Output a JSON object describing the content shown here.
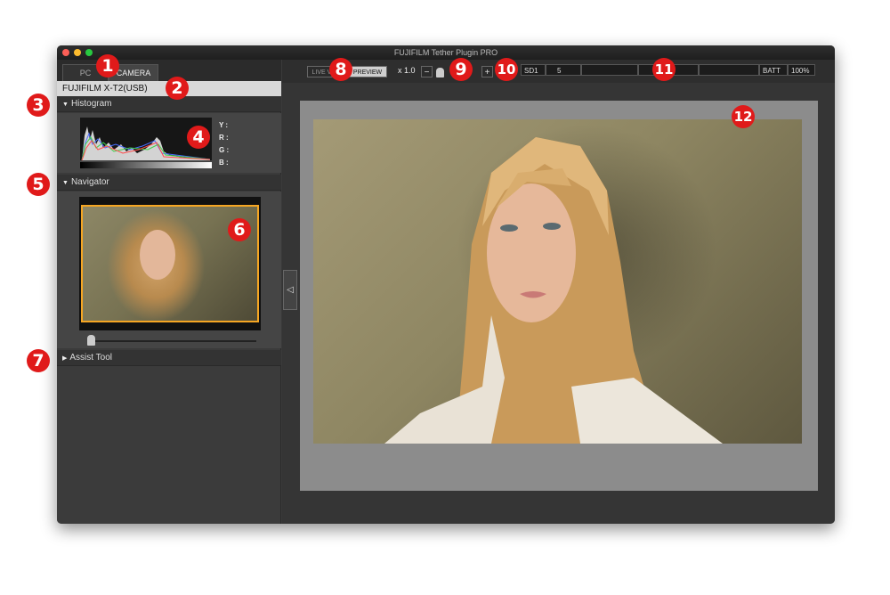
{
  "window": {
    "title": "FUJIFILM Tether Plugin PRO"
  },
  "tabs": [
    {
      "label": "PC"
    },
    {
      "label": "CAMERA"
    }
  ],
  "device": {
    "name": "FUJIFILM X-T2(USB)"
  },
  "sections": {
    "histogram": {
      "label": "Histogram",
      "readouts": [
        "Y :",
        "R :",
        "G :",
        "B :"
      ]
    },
    "navigator": {
      "label": "Navigator",
      "zoom_position": 0.05
    },
    "assist": {
      "label": "Assist Tool"
    }
  },
  "toolbar": {
    "live_view_label": "LIVE VIEW",
    "preview_label": "PREVIEW",
    "zoom_label": "x 1.0",
    "minus_label": "−",
    "plus_label": "+",
    "status": {
      "media": "SD1",
      "count": "5",
      "batt_label": "BATT",
      "batt_value": "100%"
    }
  },
  "collapse_glyph": "◁",
  "annotations": [
    "1",
    "2",
    "3",
    "4",
    "5",
    "6",
    "7",
    "8",
    "9",
    "10",
    "11",
    "12"
  ],
  "colors": {
    "window_bg": "#3a3a3a",
    "selected_frame": "#f5a623",
    "annotation_red": "#e01a1a"
  }
}
